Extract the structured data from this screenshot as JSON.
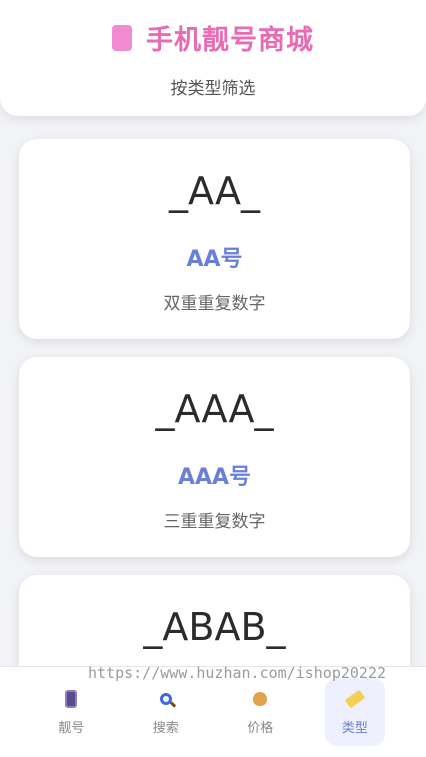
{
  "header": {
    "title": "手机靓号商城",
    "subtitle": "按类型筛选",
    "icon": "phone-icon",
    "title_color": "#e86bb3"
  },
  "types": [
    {
      "pattern": "_AA_",
      "name": "AA号",
      "desc": "双重重复数字"
    },
    {
      "pattern": "_AAA_",
      "name": "AAA号",
      "desc": "三重重复数字"
    },
    {
      "pattern": "_ABAB_",
      "name": "",
      "desc": ""
    }
  ],
  "tabbar": {
    "items": [
      {
        "label": "靓号",
        "icon": "phone-icon"
      },
      {
        "label": "搜索",
        "icon": "search-icon"
      },
      {
        "label": "价格",
        "icon": "money-bag-icon"
      },
      {
        "label": "类型",
        "icon": "tag-icon",
        "active": true
      }
    ],
    "accent": "#6a7fd8"
  },
  "watermark": "https://www.huzhan.com/ishop20222"
}
